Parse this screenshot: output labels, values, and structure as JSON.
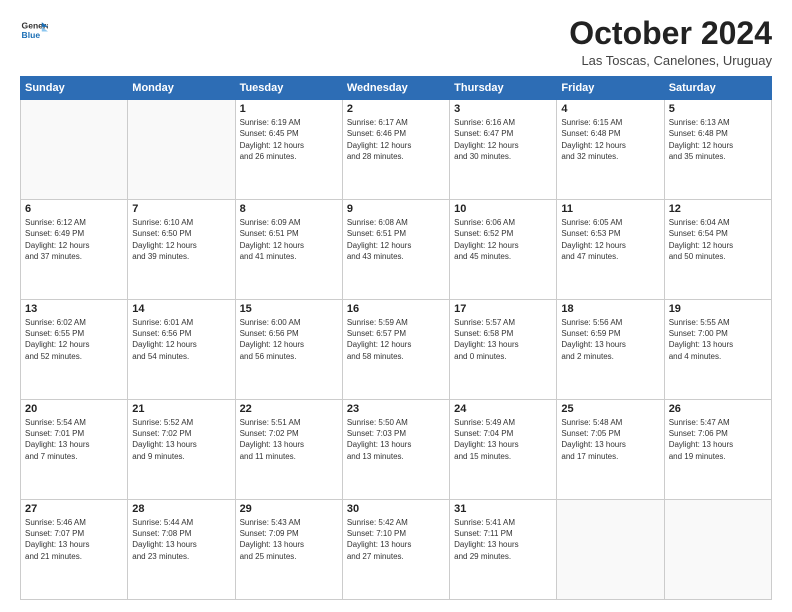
{
  "logo": {
    "line1": "General",
    "line2": "Blue"
  },
  "title": "October 2024",
  "subtitle": "Las Toscas, Canelones, Uruguay",
  "days_of_week": [
    "Sunday",
    "Monday",
    "Tuesday",
    "Wednesday",
    "Thursday",
    "Friday",
    "Saturday"
  ],
  "weeks": [
    [
      {
        "day": "",
        "info": ""
      },
      {
        "day": "",
        "info": ""
      },
      {
        "day": "1",
        "info": "Sunrise: 6:19 AM\nSunset: 6:45 PM\nDaylight: 12 hours\nand 26 minutes."
      },
      {
        "day": "2",
        "info": "Sunrise: 6:17 AM\nSunset: 6:46 PM\nDaylight: 12 hours\nand 28 minutes."
      },
      {
        "day": "3",
        "info": "Sunrise: 6:16 AM\nSunset: 6:47 PM\nDaylight: 12 hours\nand 30 minutes."
      },
      {
        "day": "4",
        "info": "Sunrise: 6:15 AM\nSunset: 6:48 PM\nDaylight: 12 hours\nand 32 minutes."
      },
      {
        "day": "5",
        "info": "Sunrise: 6:13 AM\nSunset: 6:48 PM\nDaylight: 12 hours\nand 35 minutes."
      }
    ],
    [
      {
        "day": "6",
        "info": "Sunrise: 6:12 AM\nSunset: 6:49 PM\nDaylight: 12 hours\nand 37 minutes."
      },
      {
        "day": "7",
        "info": "Sunrise: 6:10 AM\nSunset: 6:50 PM\nDaylight: 12 hours\nand 39 minutes."
      },
      {
        "day": "8",
        "info": "Sunrise: 6:09 AM\nSunset: 6:51 PM\nDaylight: 12 hours\nand 41 minutes."
      },
      {
        "day": "9",
        "info": "Sunrise: 6:08 AM\nSunset: 6:51 PM\nDaylight: 12 hours\nand 43 minutes."
      },
      {
        "day": "10",
        "info": "Sunrise: 6:06 AM\nSunset: 6:52 PM\nDaylight: 12 hours\nand 45 minutes."
      },
      {
        "day": "11",
        "info": "Sunrise: 6:05 AM\nSunset: 6:53 PM\nDaylight: 12 hours\nand 47 minutes."
      },
      {
        "day": "12",
        "info": "Sunrise: 6:04 AM\nSunset: 6:54 PM\nDaylight: 12 hours\nand 50 minutes."
      }
    ],
    [
      {
        "day": "13",
        "info": "Sunrise: 6:02 AM\nSunset: 6:55 PM\nDaylight: 12 hours\nand 52 minutes."
      },
      {
        "day": "14",
        "info": "Sunrise: 6:01 AM\nSunset: 6:56 PM\nDaylight: 12 hours\nand 54 minutes."
      },
      {
        "day": "15",
        "info": "Sunrise: 6:00 AM\nSunset: 6:56 PM\nDaylight: 12 hours\nand 56 minutes."
      },
      {
        "day": "16",
        "info": "Sunrise: 5:59 AM\nSunset: 6:57 PM\nDaylight: 12 hours\nand 58 minutes."
      },
      {
        "day": "17",
        "info": "Sunrise: 5:57 AM\nSunset: 6:58 PM\nDaylight: 13 hours\nand 0 minutes."
      },
      {
        "day": "18",
        "info": "Sunrise: 5:56 AM\nSunset: 6:59 PM\nDaylight: 13 hours\nand 2 minutes."
      },
      {
        "day": "19",
        "info": "Sunrise: 5:55 AM\nSunset: 7:00 PM\nDaylight: 13 hours\nand 4 minutes."
      }
    ],
    [
      {
        "day": "20",
        "info": "Sunrise: 5:54 AM\nSunset: 7:01 PM\nDaylight: 13 hours\nand 7 minutes."
      },
      {
        "day": "21",
        "info": "Sunrise: 5:52 AM\nSunset: 7:02 PM\nDaylight: 13 hours\nand 9 minutes."
      },
      {
        "day": "22",
        "info": "Sunrise: 5:51 AM\nSunset: 7:02 PM\nDaylight: 13 hours\nand 11 minutes."
      },
      {
        "day": "23",
        "info": "Sunrise: 5:50 AM\nSunset: 7:03 PM\nDaylight: 13 hours\nand 13 minutes."
      },
      {
        "day": "24",
        "info": "Sunrise: 5:49 AM\nSunset: 7:04 PM\nDaylight: 13 hours\nand 15 minutes."
      },
      {
        "day": "25",
        "info": "Sunrise: 5:48 AM\nSunset: 7:05 PM\nDaylight: 13 hours\nand 17 minutes."
      },
      {
        "day": "26",
        "info": "Sunrise: 5:47 AM\nSunset: 7:06 PM\nDaylight: 13 hours\nand 19 minutes."
      }
    ],
    [
      {
        "day": "27",
        "info": "Sunrise: 5:46 AM\nSunset: 7:07 PM\nDaylight: 13 hours\nand 21 minutes."
      },
      {
        "day": "28",
        "info": "Sunrise: 5:44 AM\nSunset: 7:08 PM\nDaylight: 13 hours\nand 23 minutes."
      },
      {
        "day": "29",
        "info": "Sunrise: 5:43 AM\nSunset: 7:09 PM\nDaylight: 13 hours\nand 25 minutes."
      },
      {
        "day": "30",
        "info": "Sunrise: 5:42 AM\nSunset: 7:10 PM\nDaylight: 13 hours\nand 27 minutes."
      },
      {
        "day": "31",
        "info": "Sunrise: 5:41 AM\nSunset: 7:11 PM\nDaylight: 13 hours\nand 29 minutes."
      },
      {
        "day": "",
        "info": ""
      },
      {
        "day": "",
        "info": ""
      }
    ]
  ]
}
